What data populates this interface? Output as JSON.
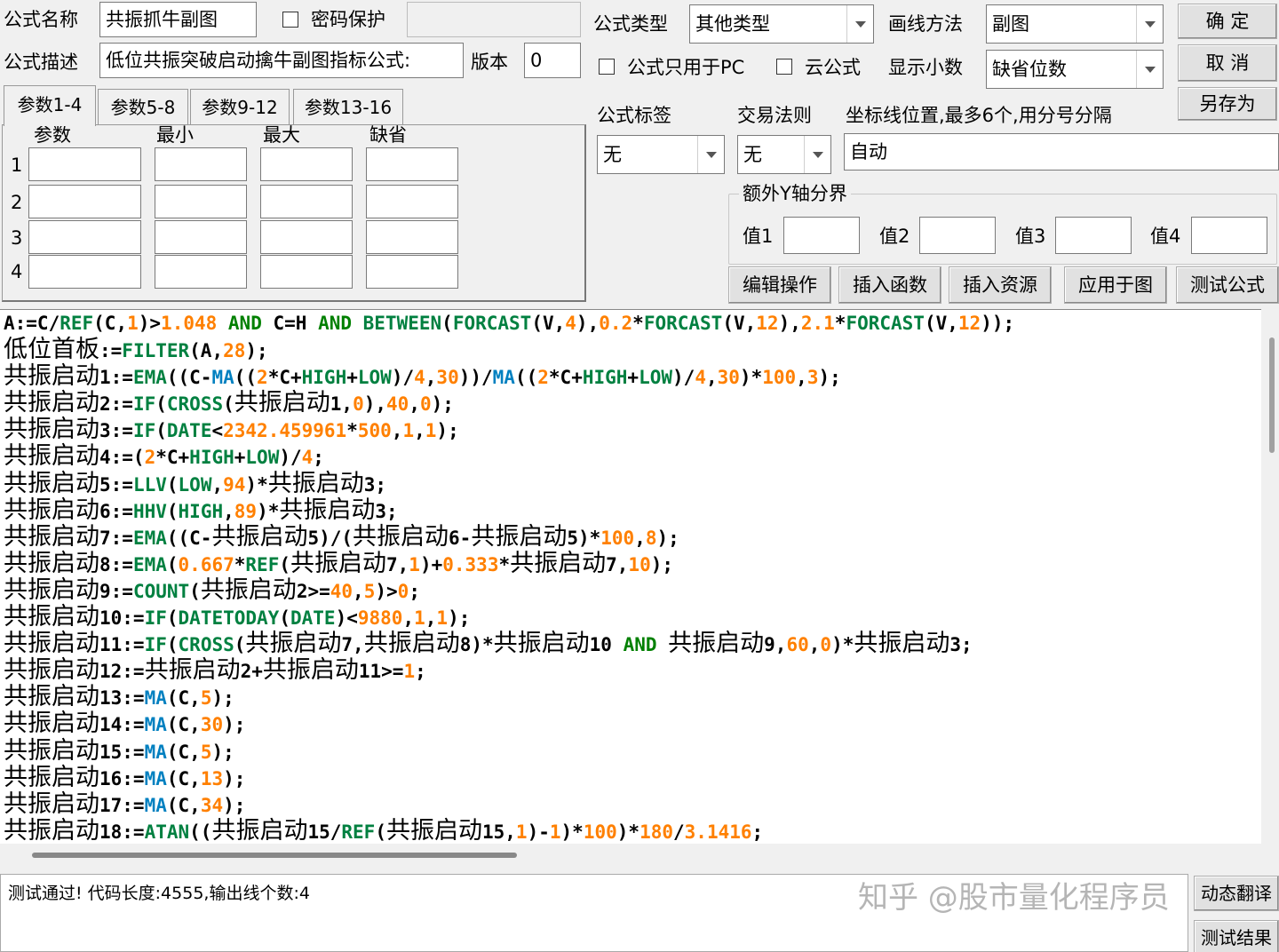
{
  "form": {
    "name_label": "公式名称",
    "name_value": "共振抓牛副图",
    "password_label": "密码保护",
    "desc_label": "公式描述",
    "desc_value": "低位共振突破启动擒牛副图指标公式:",
    "version_label": "版本",
    "version_value": "0",
    "type_label": "公式类型",
    "type_value": "其他类型",
    "draw_label": "画线方法",
    "draw_value": "副图",
    "pc_only_label": "公式只用于PC",
    "cloud_label": "云公式",
    "decimals_label": "显示小数",
    "decimals_value": "缺省位数",
    "tag_label": "公式标签",
    "tag_value": "无",
    "trade_label": "交易法则",
    "trade_value": "无",
    "axis_label": "坐标线位置,最多6个,用分号分隔",
    "axis_value": "自动",
    "extra_y_label": "额外Y轴分界",
    "val1_label": "值1",
    "val2_label": "值2",
    "val3_label": "值3",
    "val4_label": "值4"
  },
  "buttons": {
    "ok": "确 定",
    "cancel": "取 消",
    "save_as": "另存为",
    "edit_ops": "编辑操作",
    "insert_func": "插入函数",
    "insert_res": "插入资源",
    "apply_chart": "应用于图",
    "test_formula": "测试公式",
    "translate": "动态翻译",
    "test_result": "测试结果"
  },
  "params": {
    "tabs": [
      "参数1-4",
      "参数5-8",
      "参数9-12",
      "参数13-16"
    ],
    "headers": [
      "参数",
      "最小",
      "最大",
      "缺省"
    ],
    "rows": [
      "1",
      "2",
      "3",
      "4"
    ]
  },
  "code_lines": [
    [
      [
        "k",
        "A:=C/"
      ],
      [
        "f",
        "REF"
      ],
      [
        "k",
        "(C,"
      ],
      [
        "n",
        "1"
      ],
      [
        "k",
        ")>"
      ],
      [
        "n",
        "1.048"
      ],
      [
        "g",
        " AND "
      ],
      [
        "k",
        "C=H"
      ],
      [
        "g",
        " AND "
      ],
      [
        "f",
        "BETWEEN"
      ],
      [
        "k",
        "("
      ],
      [
        "f",
        "FORCAST"
      ],
      [
        "k",
        "(V,"
      ],
      [
        "n",
        "4"
      ],
      [
        "k",
        "),"
      ],
      [
        "n",
        "0.2"
      ],
      [
        "k",
        "*"
      ],
      [
        "f",
        "FORCAST"
      ],
      [
        "k",
        "(V,"
      ],
      [
        "n",
        "12"
      ],
      [
        "k",
        "),"
      ],
      [
        "n",
        "2.1"
      ],
      [
        "k",
        "*"
      ],
      [
        "f",
        "FORCAST"
      ],
      [
        "k",
        "(V,"
      ],
      [
        "n",
        "12"
      ],
      [
        "k",
        "));"
      ]
    ],
    [
      [
        "cn",
        "低位首板"
      ],
      [
        "k",
        ":="
      ],
      [
        "f",
        "FILTER"
      ],
      [
        "k",
        "(A,"
      ],
      [
        "n",
        "28"
      ],
      [
        "k",
        ");"
      ]
    ],
    [
      [
        "cn",
        "共振启动"
      ],
      [
        "k",
        "1:="
      ],
      [
        "f",
        "EMA"
      ],
      [
        "k",
        "((C-"
      ],
      [
        "f2",
        "MA"
      ],
      [
        "k",
        "(("
      ],
      [
        "n",
        "2"
      ],
      [
        "k",
        "*C+"
      ],
      [
        "f",
        "HIGH"
      ],
      [
        "k",
        "+"
      ],
      [
        "f",
        "LOW"
      ],
      [
        "k",
        ")/"
      ],
      [
        "n",
        "4"
      ],
      [
        "k",
        ","
      ],
      [
        "n",
        "30"
      ],
      [
        "k",
        "))/"
      ],
      [
        "f2",
        "MA"
      ],
      [
        "k",
        "(("
      ],
      [
        "n",
        "2"
      ],
      [
        "k",
        "*C+"
      ],
      [
        "f",
        "HIGH"
      ],
      [
        "k",
        "+"
      ],
      [
        "f",
        "LOW"
      ],
      [
        "k",
        ")/"
      ],
      [
        "n",
        "4"
      ],
      [
        "k",
        ","
      ],
      [
        "n",
        "30"
      ],
      [
        "k",
        ")*"
      ],
      [
        "n",
        "100"
      ],
      [
        "k",
        ","
      ],
      [
        "n",
        "3"
      ],
      [
        "k",
        ");"
      ]
    ],
    [
      [
        "cn",
        "共振启动"
      ],
      [
        "k",
        "2:="
      ],
      [
        "f",
        "IF"
      ],
      [
        "k",
        "("
      ],
      [
        "f",
        "CROSS"
      ],
      [
        "k",
        "("
      ],
      [
        "cn",
        "共振启动"
      ],
      [
        "k",
        "1,"
      ],
      [
        "n",
        "0"
      ],
      [
        "k",
        "),"
      ],
      [
        "n",
        "40"
      ],
      [
        "k",
        ","
      ],
      [
        "n",
        "0"
      ],
      [
        "k",
        ");"
      ]
    ],
    [
      [
        "cn",
        "共振启动"
      ],
      [
        "k",
        "3:="
      ],
      [
        "f",
        "IF"
      ],
      [
        "k",
        "("
      ],
      [
        "f",
        "DATE"
      ],
      [
        "k",
        "<"
      ],
      [
        "n",
        "2342.459961"
      ],
      [
        "k",
        "*"
      ],
      [
        "n",
        "500"
      ],
      [
        "k",
        ","
      ],
      [
        "n",
        "1"
      ],
      [
        "k",
        ","
      ],
      [
        "n",
        "1"
      ],
      [
        "k",
        ");"
      ]
    ],
    [
      [
        "cn",
        "共振启动"
      ],
      [
        "k",
        "4:=("
      ],
      [
        "n",
        "2"
      ],
      [
        "k",
        "*C+"
      ],
      [
        "f",
        "HIGH"
      ],
      [
        "k",
        "+"
      ],
      [
        "f",
        "LOW"
      ],
      [
        "k",
        ")/"
      ],
      [
        "n",
        "4"
      ],
      [
        "k",
        ";"
      ]
    ],
    [
      [
        "cn",
        "共振启动"
      ],
      [
        "k",
        "5:="
      ],
      [
        "f",
        "LLV"
      ],
      [
        "k",
        "("
      ],
      [
        "f",
        "LOW"
      ],
      [
        "k",
        ","
      ],
      [
        "n",
        "94"
      ],
      [
        "k",
        ")*"
      ],
      [
        "cn",
        "共振启动"
      ],
      [
        "k",
        "3;"
      ]
    ],
    [
      [
        "cn",
        "共振启动"
      ],
      [
        "k",
        "6:="
      ],
      [
        "f",
        "HHV"
      ],
      [
        "k",
        "("
      ],
      [
        "f",
        "HIGH"
      ],
      [
        "k",
        ","
      ],
      [
        "n",
        "89"
      ],
      [
        "k",
        ")*"
      ],
      [
        "cn",
        "共振启动"
      ],
      [
        "k",
        "3;"
      ]
    ],
    [
      [
        "cn",
        "共振启动"
      ],
      [
        "k",
        "7:="
      ],
      [
        "f",
        "EMA"
      ],
      [
        "k",
        "((C-"
      ],
      [
        "cn",
        "共振启动"
      ],
      [
        "k",
        "5)/("
      ],
      [
        "cn",
        "共振启动"
      ],
      [
        "k",
        "6-"
      ],
      [
        "cn",
        "共振启动"
      ],
      [
        "k",
        "5)*"
      ],
      [
        "n",
        "100"
      ],
      [
        "k",
        ","
      ],
      [
        "n",
        "8"
      ],
      [
        "k",
        ");"
      ]
    ],
    [
      [
        "cn",
        "共振启动"
      ],
      [
        "k",
        "8:="
      ],
      [
        "f",
        "EMA"
      ],
      [
        "k",
        "("
      ],
      [
        "n",
        "0.667"
      ],
      [
        "k",
        "*"
      ],
      [
        "f",
        "REF"
      ],
      [
        "k",
        "("
      ],
      [
        "cn",
        "共振启动"
      ],
      [
        "k",
        "7,"
      ],
      [
        "n",
        "1"
      ],
      [
        "k",
        ")+"
      ],
      [
        "n",
        "0.333"
      ],
      [
        "k",
        "*"
      ],
      [
        "cn",
        "共振启动"
      ],
      [
        "k",
        "7,"
      ],
      [
        "n",
        "10"
      ],
      [
        "k",
        ");"
      ]
    ],
    [
      [
        "cn",
        "共振启动"
      ],
      [
        "k",
        "9:="
      ],
      [
        "f",
        "COUNT"
      ],
      [
        "k",
        "("
      ],
      [
        "cn",
        "共振启动"
      ],
      [
        "k",
        "2>="
      ],
      [
        "n",
        "40"
      ],
      [
        "k",
        ","
      ],
      [
        "n",
        "5"
      ],
      [
        "k",
        ")>"
      ],
      [
        "n",
        "0"
      ],
      [
        "k",
        ";"
      ]
    ],
    [
      [
        "cn",
        "共振启动"
      ],
      [
        "k",
        "10:="
      ],
      [
        "f",
        "IF"
      ],
      [
        "k",
        "("
      ],
      [
        "f",
        "DATETODAY"
      ],
      [
        "k",
        "("
      ],
      [
        "f",
        "DATE"
      ],
      [
        "k",
        ")<"
      ],
      [
        "n",
        "9880"
      ],
      [
        "k",
        ","
      ],
      [
        "n",
        "1"
      ],
      [
        "k",
        ","
      ],
      [
        "n",
        "1"
      ],
      [
        "k",
        ");"
      ]
    ],
    [
      [
        "cn",
        "共振启动"
      ],
      [
        "k",
        "11:="
      ],
      [
        "f",
        "IF"
      ],
      [
        "k",
        "("
      ],
      [
        "f",
        "CROSS"
      ],
      [
        "k",
        "("
      ],
      [
        "cn",
        "共振启动"
      ],
      [
        "k",
        "7,"
      ],
      [
        "cn",
        "共振启动"
      ],
      [
        "k",
        "8)*"
      ],
      [
        "cn",
        "共振启动"
      ],
      [
        "k",
        "10"
      ],
      [
        "g",
        " AND "
      ],
      [
        "cn",
        "共振启动"
      ],
      [
        "k",
        "9,"
      ],
      [
        "n",
        "60"
      ],
      [
        "k",
        ","
      ],
      [
        "n",
        "0"
      ],
      [
        "k",
        ")*"
      ],
      [
        "cn",
        "共振启动"
      ],
      [
        "k",
        "3;"
      ]
    ],
    [
      [
        "cn",
        "共振启动"
      ],
      [
        "k",
        "12:="
      ],
      [
        "cn",
        "共振启动"
      ],
      [
        "k",
        "2+"
      ],
      [
        "cn",
        "共振启动"
      ],
      [
        "k",
        "11>="
      ],
      [
        "n",
        "1"
      ],
      [
        "k",
        ";"
      ]
    ],
    [
      [
        "cn",
        "共振启动"
      ],
      [
        "k",
        "13:="
      ],
      [
        "f2",
        "MA"
      ],
      [
        "k",
        "(C,"
      ],
      [
        "n",
        "5"
      ],
      [
        "k",
        ");"
      ]
    ],
    [
      [
        "cn",
        "共振启动"
      ],
      [
        "k",
        "14:="
      ],
      [
        "f2",
        "MA"
      ],
      [
        "k",
        "(C,"
      ],
      [
        "n",
        "30"
      ],
      [
        "k",
        ");"
      ]
    ],
    [
      [
        "cn",
        "共振启动"
      ],
      [
        "k",
        "15:="
      ],
      [
        "f2",
        "MA"
      ],
      [
        "k",
        "(C,"
      ],
      [
        "n",
        "5"
      ],
      [
        "k",
        ");"
      ]
    ],
    [
      [
        "cn",
        "共振启动"
      ],
      [
        "k",
        "16:="
      ],
      [
        "f2",
        "MA"
      ],
      [
        "k",
        "(C,"
      ],
      [
        "n",
        "13"
      ],
      [
        "k",
        ");"
      ]
    ],
    [
      [
        "cn",
        "共振启动"
      ],
      [
        "k",
        "17:="
      ],
      [
        "f2",
        "MA"
      ],
      [
        "k",
        "(C,"
      ],
      [
        "n",
        "34"
      ],
      [
        "k",
        ");"
      ]
    ],
    [
      [
        "cn",
        "共振启动"
      ],
      [
        "k",
        "18:="
      ],
      [
        "f",
        "ATAN"
      ],
      [
        "k",
        "(("
      ],
      [
        "cn",
        "共振启动"
      ],
      [
        "k",
        "15/"
      ],
      [
        "f",
        "REF"
      ],
      [
        "k",
        "("
      ],
      [
        "cn",
        "共振启动"
      ],
      [
        "k",
        "15,"
      ],
      [
        "n",
        "1"
      ],
      [
        "k",
        ")-"
      ],
      [
        "n",
        "1"
      ],
      [
        "k",
        ")*"
      ],
      [
        "n",
        "100"
      ],
      [
        "k",
        ")*"
      ],
      [
        "n",
        "180"
      ],
      [
        "k",
        "/"
      ],
      [
        "n",
        "3.1416"
      ],
      [
        "k",
        ";"
      ]
    ]
  ],
  "status_text": "测试通过! 代码长度:4555,输出线个数:4",
  "watermark": "知乎 @股市量化程序员"
}
